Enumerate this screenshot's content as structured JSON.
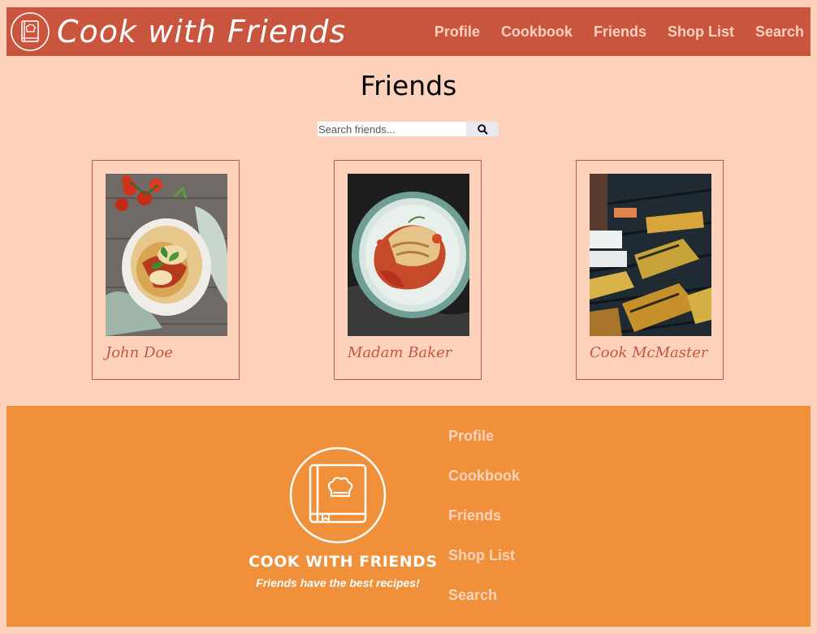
{
  "header": {
    "brand_title": "Cook with Friends",
    "nav": [
      "Profile",
      "Cookbook",
      "Friends",
      "Shop List",
      "Search"
    ]
  },
  "main": {
    "title": "Friends",
    "search": {
      "placeholder": "Search friends...",
      "button_icon": "search-icon"
    },
    "friends": [
      {
        "name": "John Doe",
        "photo": "baked eggplant parmigiana dish with basil and cherry tomatoes"
      },
      {
        "name": "Madam Baker",
        "photo": "plate of lasagna with tomato sauce"
      },
      {
        "name": "Cook McMaster",
        "photo": "grilled vegetables on a barbecue grill"
      }
    ]
  },
  "footer": {
    "brand": "COOK WITH FRIENDS",
    "tagline": "Friends have the best recipes!",
    "nav": [
      "Profile",
      "Cookbook",
      "Friends",
      "Shop List",
      "Search"
    ]
  },
  "colors": {
    "background": "#ffd2bc",
    "header": "#c9553f",
    "footer": "#f0903b",
    "nav_text": "#ffd2bc",
    "accent": "#c9553f"
  }
}
